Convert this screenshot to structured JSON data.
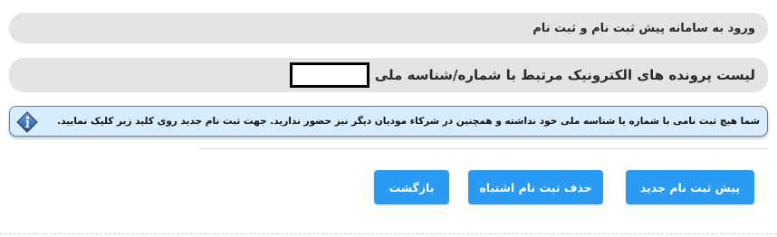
{
  "header": {
    "login_title": "ورود به سامانه پیش ثبت نام و ثبت نام",
    "list_title": "لیست پرونده های الکترونیک مرتبط با شماره/شناسه ملی"
  },
  "info": {
    "message": "شما هیچ ثبت نامی با شماره یا شناسه ملی خود نداشته و همچنین در شرکاء مودیان دیگر نیز حضور ندارید. جهت ثبت نام جدید روی کلید زیر کلیک نمایید.",
    "icon": "info-icon"
  },
  "actions": {
    "new_registration": "پیش ثبت نام جدید",
    "delete_wrong": "حذف ثبت نام اشتباه",
    "back": "بازگشت"
  },
  "colors": {
    "button": "#2b9af3",
    "info_background": "#d6ecff",
    "title_background": "#e4e4e4"
  }
}
